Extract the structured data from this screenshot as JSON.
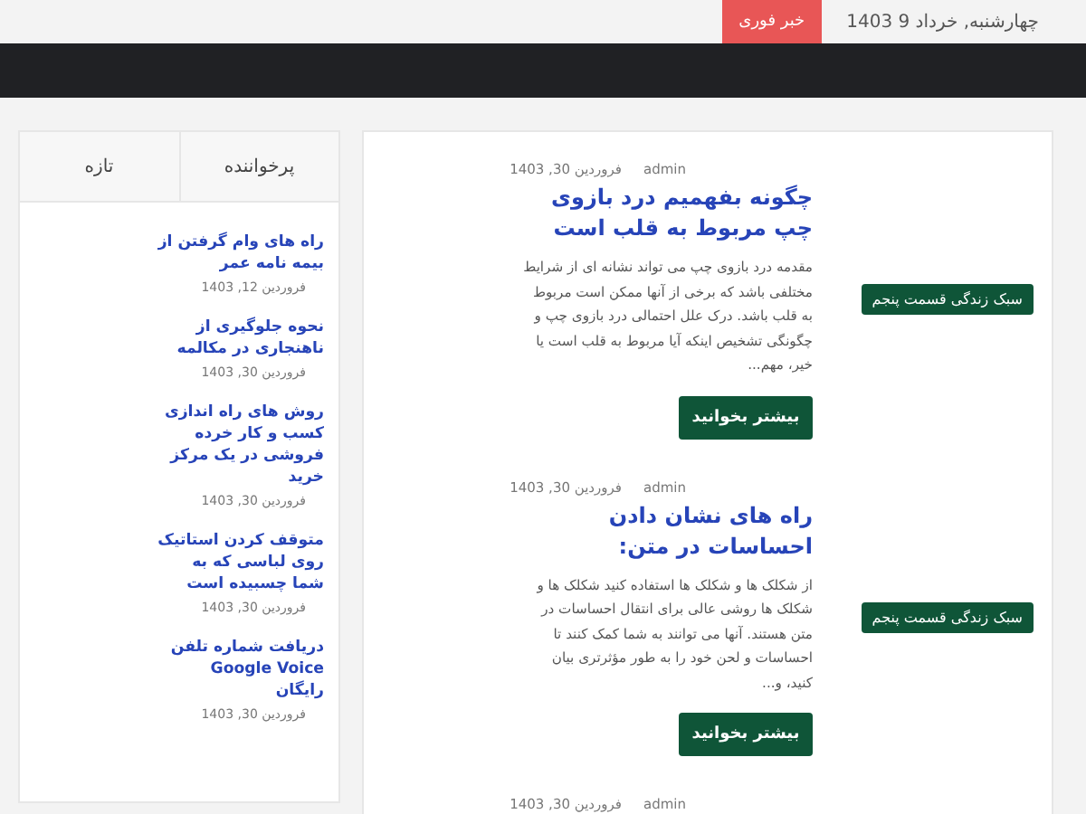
{
  "topbar": {
    "date": "چهارشنبه, خرداد 9 1403",
    "badge": "خبر فوری"
  },
  "posts": [
    {
      "author": "admin",
      "date": "فروردین 30, 1403",
      "title": "چگونه بفهمیم درد بازوی چپ مربوط به قلب است",
      "excerpt": "مقدمه درد بازوی چپ می تواند نشانه ای از شرایط مختلفی باشد که برخی از آنها ممکن است مربوط به قلب باشد. درک علل احتمالی درد بازوی چپ و چگونگی تشخیص اینکه آیا مربوط به قلب است یا خیر، مهم...",
      "button": "بیشتر بخوانید",
      "category": "سبک زندگی قسمت پنجم"
    },
    {
      "author": "admin",
      "date": "فروردین 30, 1403",
      "title": "راه های نشان دادن احساسات در متن:",
      "excerpt": "از شکلک ها و شکلک ها استفاده کنید شکلک ها و شکلک ها روشی عالی برای انتقال احساسات در متن هستند. آنها می توانند به شما کمک کنند تا احساسات و لحن خود را به طور مؤثرتری بیان کنید، و...",
      "button": "بیشتر بخوانید",
      "category": "سبک زندگی قسمت پنجم"
    },
    {
      "author": "admin",
      "date": "فروردین 30, 1403"
    }
  ],
  "sidebar": {
    "tabs": [
      {
        "label": "پرخواننده"
      },
      {
        "label": "تازه"
      }
    ],
    "items": [
      {
        "title": "راه های وام گرفتن از بیمه نامه عمر",
        "date": "فروردین 12, 1403"
      },
      {
        "title": "نحوه جلوگیری از ناهنجاری در مکالمه",
        "date": "فروردین 30, 1403"
      },
      {
        "title": "روش های راه اندازی کسب و کار خرده فروشی در یک مرکز خرید",
        "date": "فروردین 30, 1403"
      },
      {
        "title": "متوقف کردن استاتیک روی لباسی که به شما چسبیده است",
        "date": "فروردین 30, 1403"
      },
      {
        "title": "دریافت شماره تلفن Google Voice رایگان",
        "date": "فروردین 30, 1403"
      }
    ]
  }
}
